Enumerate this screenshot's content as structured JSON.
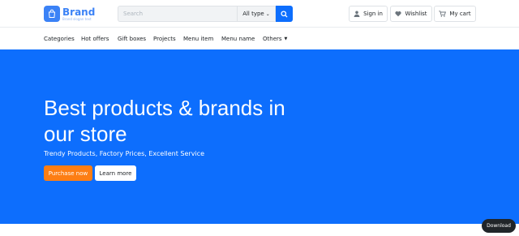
{
  "brand": {
    "name": "Brand",
    "tagline": "Brand slogan text"
  },
  "search": {
    "placeholder": "Search",
    "type_label": "All type"
  },
  "header_actions": {
    "signin": "Sign in",
    "wishlist": "Wishlist",
    "cart": "My cart"
  },
  "nav": {
    "items": [
      "Categories",
      "Hot offers",
      "Gift boxes",
      "Projects",
      "Menu item",
      "Menu name",
      "Others"
    ]
  },
  "hero": {
    "title": "Best products & brands in our store",
    "subtitle": "Trendy Products, Factory Prices, Excellent Service",
    "primary_button": "Purchase now",
    "secondary_button": "Learn more"
  },
  "download_label": "Download",
  "colors": {
    "accent": "#0d6efd",
    "brand": "#3b82f6",
    "orange": "#fd7e14"
  }
}
